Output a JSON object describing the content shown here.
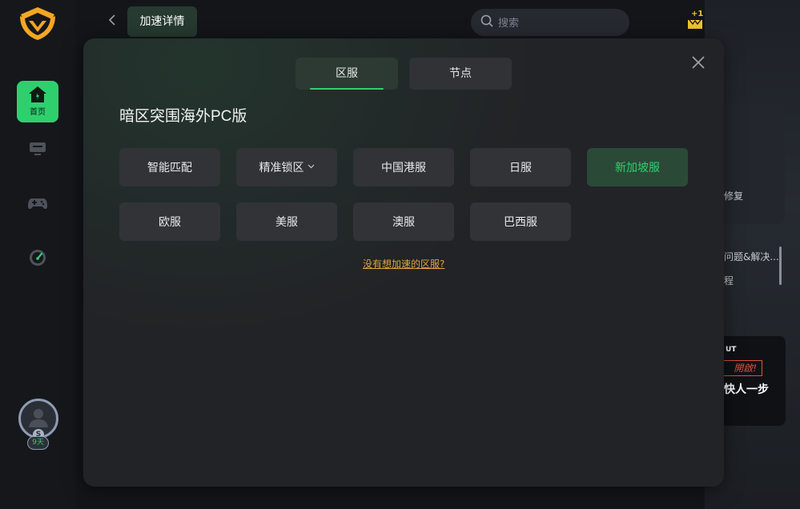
{
  "sidebar": {
    "items": [
      {
        "label": "首页",
        "icon": "home-icon",
        "active": true
      },
      {
        "label": "",
        "icon": "monitor-icon",
        "active": false
      },
      {
        "label": "",
        "icon": "gamepad-icon",
        "active": false
      },
      {
        "label": "",
        "icon": "speedometer-icon",
        "active": false
      }
    ],
    "user": {
      "level_letter": "S",
      "days": "9天"
    }
  },
  "header": {
    "back_icon": "chevron-left-icon",
    "page_tab": "加速详情",
    "search": {
      "placeholder": "搜索",
      "value": ""
    },
    "icons": [
      "gift-plus-one-icon",
      "apps-grid-icon",
      "minimize-icon",
      "close-icon"
    ],
    "gift_badge": "+1"
  },
  "background": {
    "texts": [
      "修复",
      "问题&解决...",
      "程"
    ],
    "banner": {
      "brand": "UT",
      "tag": "開啟!",
      "slogan": "快人一步"
    }
  },
  "modal": {
    "tabs": [
      {
        "label": "区服",
        "active": true
      },
      {
        "label": "节点",
        "active": false
      }
    ],
    "game_title": "暗区突围海外PC版",
    "regions": [
      {
        "label": "智能匹配",
        "selected": false,
        "has_dropdown": false
      },
      {
        "label": "精准锁区",
        "selected": false,
        "has_dropdown": true
      },
      {
        "label": "中国港服",
        "selected": false,
        "has_dropdown": false
      },
      {
        "label": "日服",
        "selected": false,
        "has_dropdown": false
      },
      {
        "label": "新加坡服",
        "selected": true,
        "has_dropdown": false
      },
      {
        "label": "欧服",
        "selected": false,
        "has_dropdown": false
      },
      {
        "label": "美服",
        "selected": false,
        "has_dropdown": false
      },
      {
        "label": "澳服",
        "selected": false,
        "has_dropdown": false
      },
      {
        "label": "巴西服",
        "selected": false,
        "has_dropdown": false
      }
    ],
    "help_link": "没有想加速的区服?"
  },
  "colors": {
    "accent": "#2ed06e",
    "link": "#e0a33c",
    "modal_bg": "#222326",
    "app_bg": "#131519"
  }
}
